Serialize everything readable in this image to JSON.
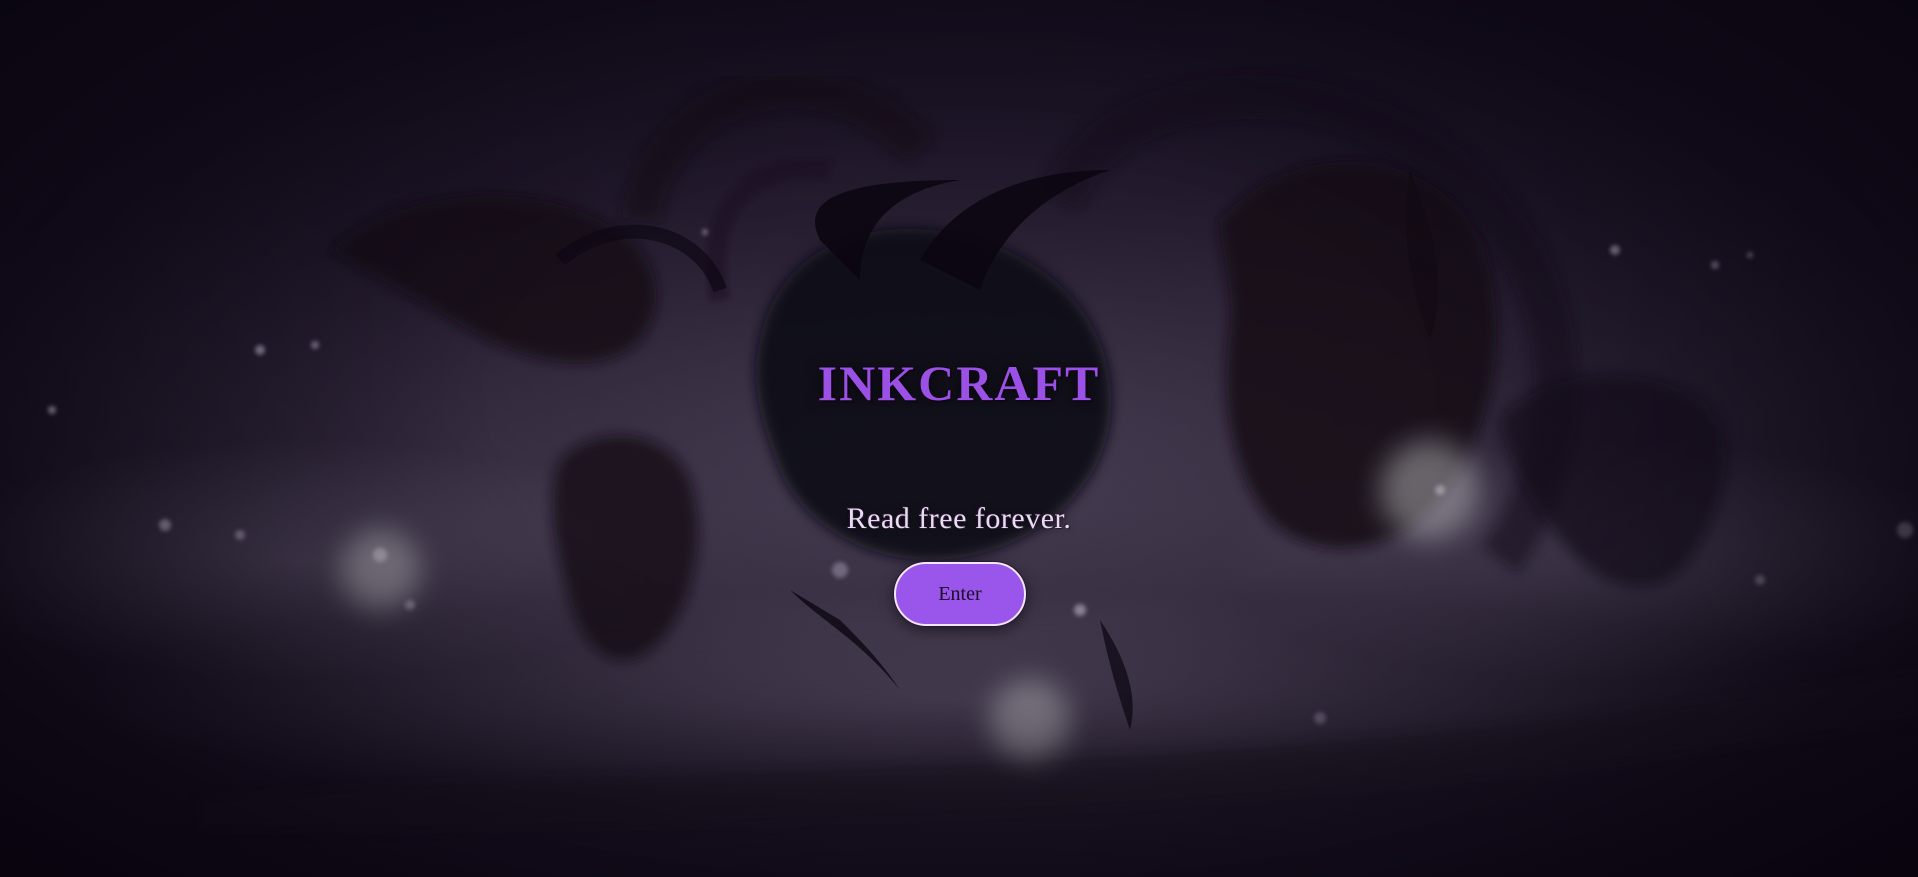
{
  "hero": {
    "brand": "INKCRAFT",
    "tagline": "Read free forever.",
    "enter_label": "Enter"
  },
  "colors": {
    "brand_purple": "#9b51e6",
    "button_fill": "#9a55ea",
    "tagline_text": "#e8dcef",
    "background_dark": "#120c1a"
  },
  "background": {
    "icon": "ink-dragons-illustration"
  }
}
